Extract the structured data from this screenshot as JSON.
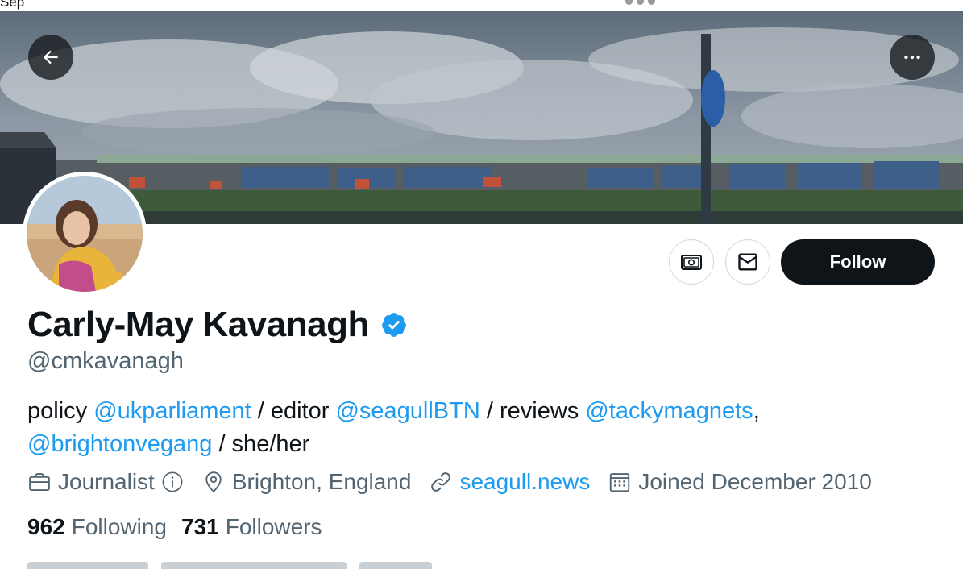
{
  "status_bar": {
    "left_text": "Sep"
  },
  "profile": {
    "display_name": "Carly-May Kavanagh",
    "handle": "@cmkavanagh",
    "verified": true,
    "bio": {
      "t1": "policy ",
      "m1": "@ukparliament",
      "t2": " / editor ",
      "m2": "@seagullBTN",
      "t3": " / reviews ",
      "m3": "@tackymagnets",
      "t4": ",",
      "m4": "@brightonvegang",
      "t5": " / she/her"
    },
    "category": "Journalist",
    "location": "Brighton, England",
    "website": "seagull.news",
    "joined": "Joined December 2010",
    "following_count": "962",
    "following_label": "Following",
    "followers_count": "731",
    "followers_label": "Followers"
  },
  "actions": {
    "follow_label": "Follow"
  },
  "icons": {
    "back": "arrow-left-icon",
    "more": "more-horizontal-icon",
    "tip": "tip-jar-icon",
    "message": "envelope-icon",
    "verified": "verified-badge-icon",
    "category": "briefcase-icon",
    "info": "info-icon",
    "location": "map-pin-icon",
    "website": "link-icon",
    "joined": "calendar-icon"
  },
  "colors": {
    "accent": "#1d9bf0",
    "text_primary": "#0f1419",
    "text_secondary": "#536471",
    "follow_bg": "#0f1419"
  }
}
